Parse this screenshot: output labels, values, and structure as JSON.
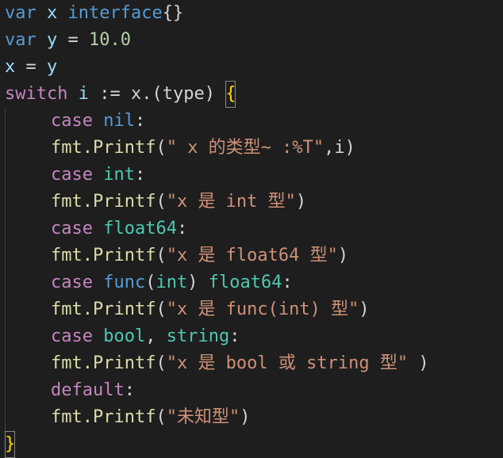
{
  "colors": {
    "background": "#1e1e1e",
    "keyword": "#569cd6",
    "control_keyword": "#c586c0",
    "identifier": "#9cdcfe",
    "type": "#4ec9b0",
    "function": "#dcdcaa",
    "number": "#b5cea8",
    "string": "#ce9178",
    "plain": "#d4d4d4",
    "bracket": "#ffd700"
  },
  "code": {
    "l1": {
      "kw": "var",
      "sp1": " ",
      "ident": "x",
      "sp2": " ",
      "type": "interface",
      "brace": "{}"
    },
    "l2": {
      "kw": "var",
      "sp1": " ",
      "ident": "y",
      "op": " = ",
      "num": "10.0"
    },
    "l3": {
      "ident1": "x",
      "op": " = ",
      "ident2": "y"
    },
    "l4": {
      "kw": "switch",
      "sp1": " ",
      "ident": "i",
      "op": " := ",
      "expr": "x.(",
      "kwtype": "type",
      "close": ")",
      "sp2": " ",
      "brace": "{"
    },
    "l5": {
      "kw": "case",
      "sp": " ",
      "val": "nil",
      "colon": ":"
    },
    "l6": {
      "fn": "fmt.Printf",
      "open": "(",
      "str": "\" x 的类型~ :%T\"",
      "rest": ",i)"
    },
    "l7": {
      "kw": "case",
      "sp": " ",
      "type": "int",
      "colon": ":"
    },
    "l8": {
      "fn": "fmt.Printf",
      "open": "(",
      "str": "\"x 是 int 型\"",
      "close": ")"
    },
    "l9": {
      "kw": "case",
      "sp": " ",
      "type": "float64",
      "colon": ":"
    },
    "l10": {
      "fn": "fmt.Printf",
      "open": "(",
      "str": "\"x 是 float64 型\"",
      "close": ")"
    },
    "l11": {
      "kw": "case",
      "sp": " ",
      "kwfunc": "func",
      "open": "(",
      "type1": "int",
      "close": ")",
      "sp2": " ",
      "type2": "float64",
      "colon": ":"
    },
    "l12": {
      "fn": "fmt.Printf",
      "open": "(",
      "str": "\"x 是 func(int) 型\"",
      "close": ")"
    },
    "l13": {
      "kw": "case",
      "sp": " ",
      "type1": "bool",
      "comma": ", ",
      "type2": "string",
      "colon": ":"
    },
    "l14": {
      "fn": "fmt.Printf",
      "open": "(",
      "str": "\"x 是 bool 或 string 型\"",
      "close": " )"
    },
    "l15": {
      "kw": "default",
      "colon": ":"
    },
    "l16": {
      "fn": "fmt.Printf",
      "open": "(",
      "str": "\"未知型\"",
      "close": ")"
    },
    "l17": {
      "brace": "}"
    }
  }
}
